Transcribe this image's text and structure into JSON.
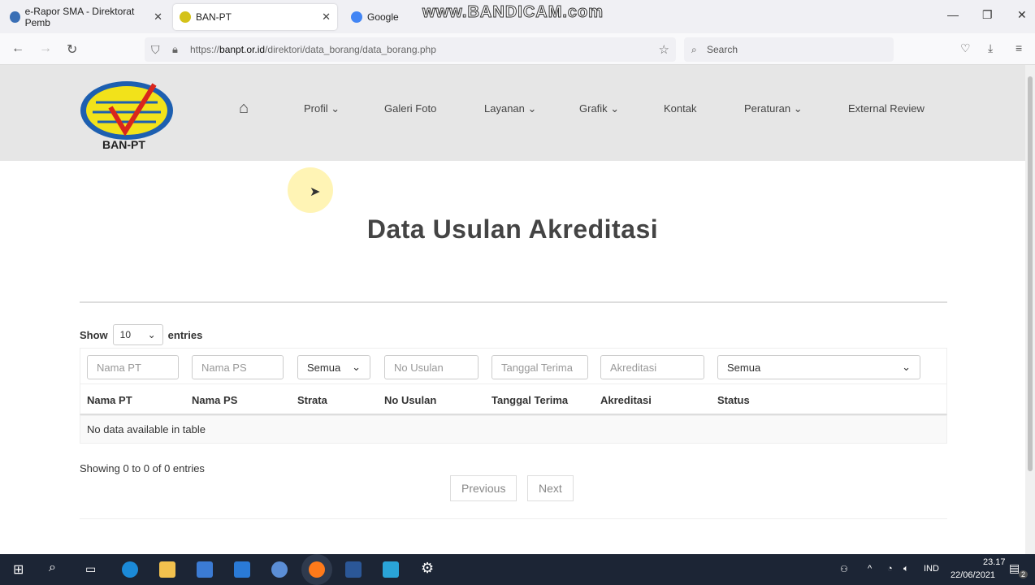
{
  "browser": {
    "tabs": [
      {
        "title": "e-Rapor SMA - Direktorat Pemb"
      },
      {
        "title": "BAN-PT"
      },
      {
        "title": "Google"
      }
    ],
    "url_prefix": "https://",
    "url_domain": "banpt.or.id",
    "url_path": "/direktori/data_borang/data_borang.php",
    "search_placeholder": "Search"
  },
  "watermark": "www.BANDICAM.com",
  "site": {
    "logo_text": "BAN-PT",
    "menu": [
      {
        "label": "Profil ⌄"
      },
      {
        "label": "Galeri Foto"
      },
      {
        "label": "Layanan ⌄"
      },
      {
        "label": "Grafik ⌄"
      },
      {
        "label": "Kontak"
      },
      {
        "label": "Peraturan ⌄"
      },
      {
        "label": "External Review"
      }
    ]
  },
  "page": {
    "title": "Data Usulan Akreditasi",
    "show_label": "Show",
    "entries_value": "10",
    "entries_label": "entries",
    "filters": {
      "nama_pt": "Nama PT",
      "nama_ps": "Nama PS",
      "strata": "Semua",
      "no_usulan": "No Usulan",
      "tanggal": "Tanggal Terima",
      "akreditasi": "Akreditasi",
      "status": "Semua"
    },
    "columns": [
      "Nama PT",
      "Nama PS",
      "Strata",
      "No Usulan",
      "Tanggal Terima",
      "Akreditasi",
      "Status"
    ],
    "empty_text": "No data available in table",
    "info": "Showing 0 to 0 of 0 entries",
    "prev": "Previous",
    "next": "Next"
  },
  "taskbar": {
    "lang": "IND",
    "time": "23.17",
    "date": "22/06/2021",
    "notifications": "2"
  }
}
